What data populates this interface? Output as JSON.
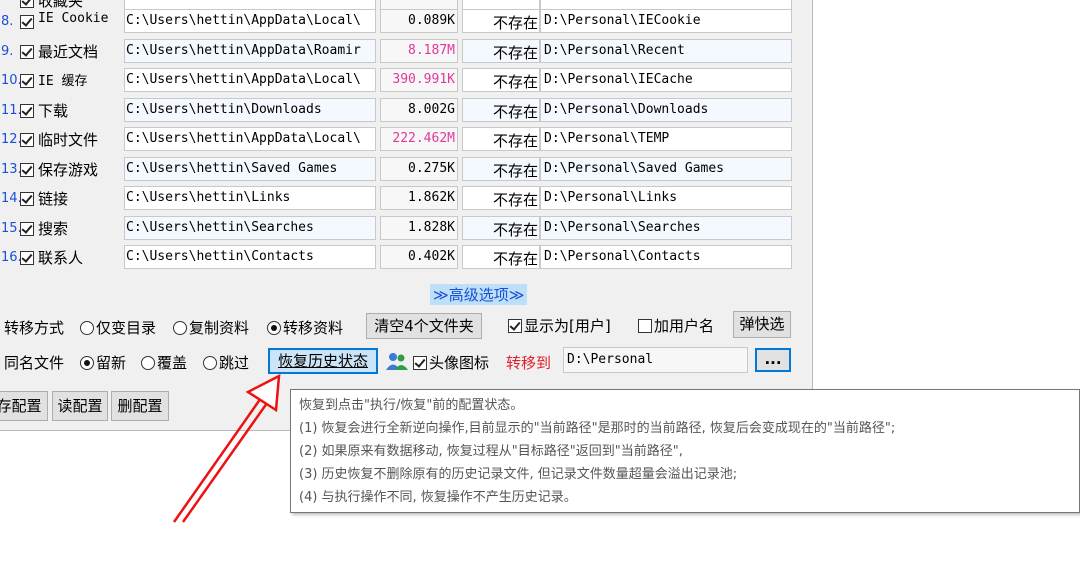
{
  "rows": [
    {
      "idx": "",
      "name": "收藏夹",
      "src": "",
      "size": "",
      "exist": "",
      "dst": "",
      "partial": true
    },
    {
      "idx": "8.",
      "name": "IE Cookie",
      "src": "C:\\Users\\hettin\\AppData\\Local\\",
      "size": "0.089K",
      "big": false,
      "exist": "不存在",
      "dst": "D:\\Personal\\IECookie"
    },
    {
      "idx": "9.",
      "name": "最近文档",
      "src": "C:\\Users\\hettin\\AppData\\Roamir",
      "size": "8.187M",
      "big": true,
      "exist": "不存在",
      "dst": "D:\\Personal\\Recent"
    },
    {
      "idx": "10.",
      "name": "IE 缓存",
      "src": "C:\\Users\\hettin\\AppData\\Local\\",
      "size": "390.991K",
      "big": true,
      "exist": "不存在",
      "dst": "D:\\Personal\\IECache"
    },
    {
      "idx": "11.",
      "name": "下载",
      "src": "C:\\Users\\hettin\\Downloads",
      "size": "8.002G",
      "big": false,
      "exist": "不存在",
      "dst": "D:\\Personal\\Downloads"
    },
    {
      "idx": "12.",
      "name": "临时文件",
      "src": "C:\\Users\\hettin\\AppData\\Local\\",
      "size": "222.462M",
      "big": true,
      "exist": "不存在",
      "dst": "D:\\Personal\\TEMP"
    },
    {
      "idx": "13.",
      "name": "保存游戏",
      "src": "C:\\Users\\hettin\\Saved Games",
      "size": "0.275K",
      "big": false,
      "exist": "不存在",
      "dst": "D:\\Personal\\Saved Games"
    },
    {
      "idx": "14.",
      "name": "链接",
      "src": "C:\\Users\\hettin\\Links",
      "size": "1.862K",
      "big": false,
      "exist": "不存在",
      "dst": "D:\\Personal\\Links"
    },
    {
      "idx": "15.",
      "name": "搜索",
      "src": "C:\\Users\\hettin\\Searches",
      "size": "1.828K",
      "big": false,
      "exist": "不存在",
      "dst": "D:\\Personal\\Searches"
    },
    {
      "idx": "16.",
      "name": "联系人",
      "src": "C:\\Users\\hettin\\Contacts",
      "size": "0.402K",
      "big": false,
      "exist": "不存在",
      "dst": "D:\\Personal\\Contacts"
    }
  ],
  "advanced": "≫高级选项≫",
  "transfer": {
    "label": "转移方式",
    "opt_dir": "仅变目录",
    "opt_copy": "复制资料",
    "opt_move": "转移资料",
    "clear_btn": "清空4个文件夹",
    "show_as_user": "显示为[用户]",
    "add_username": "加用户名",
    "popup_btn": "弹快选"
  },
  "samename": {
    "label": "同名文件",
    "opt_keep": "留新",
    "opt_overwrite": "覆盖",
    "opt_skip": "跳过",
    "restore_btn": "恢复历史状态",
    "avatar_icon_label": "头像图标",
    "move_to_label": "转移到",
    "move_to_value": "D:\\Personal",
    "browse_btn": "..."
  },
  "config": {
    "save": "存配置",
    "read": "读配置",
    "delete": "删配置"
  },
  "tooltip": {
    "lines": [
      "恢复到点击\"执行/恢复\"前的配置状态。",
      "(1) 恢复会进行全新逆向操作,目前显示的\"当前路径\"是那时的当前路径, 恢复后会变成现在的\"当前路径\";",
      "(2) 如果原来有数据移动, 恢复过程从\"目标路径\"返回到\"当前路径\",",
      "(3) 历史恢复不删除原有的历史记录文件, 但记录文件数量超量会溢出记录池;",
      "(4) 与执行操作不同, 恢复操作不产生历史记录。"
    ]
  },
  "colors": {
    "index_blue": "#1a4fd6",
    "size_pink": "#e0399a",
    "move_to_red": "#e0202a",
    "arrow_red": "#ee1111"
  }
}
